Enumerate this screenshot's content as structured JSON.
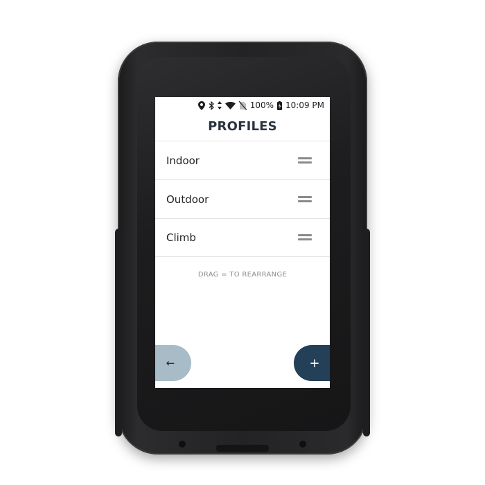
{
  "status_bar": {
    "battery": "100%",
    "time": "10:09 PM",
    "icons": [
      "location-pin-icon",
      "bluetooth-icon",
      "transfer-arrows-icon",
      "wifi-icon",
      "no-sim-icon",
      "battery-charging-icon"
    ]
  },
  "header": {
    "title": "PROFILES"
  },
  "profiles": {
    "items": [
      {
        "label": "Indoor",
        "handle_icon": "drag-handle-icon"
      },
      {
        "label": "Outdoor",
        "handle_icon": "drag-handle-icon"
      },
      {
        "label": "Climb",
        "handle_icon": "drag-handle-icon"
      }
    ]
  },
  "hint": {
    "text": "DRAG = TO REARRANGE"
  },
  "buttons": {
    "back_icon": "←",
    "add_icon": "+"
  },
  "colors": {
    "title": "#2b3440",
    "back_button": "#a8bcc7",
    "add_button": "#234058",
    "divider": "#e2e2e2"
  }
}
